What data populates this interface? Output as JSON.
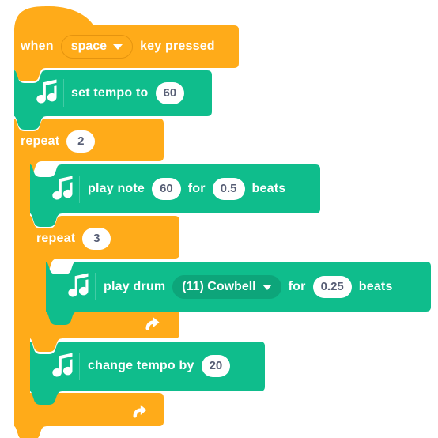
{
  "editor": {
    "name": "scratch-block-script",
    "background_color": "#ffffff"
  },
  "palette": {
    "events_orange": "#ffab19",
    "events_orange_dark": "#e5940f",
    "control_orange": "#ffab19",
    "music_green": "#0fbd8c",
    "music_green_dark": "#0da57a",
    "input_white": "#ffffff",
    "input_text": "#575e75",
    "label_white": "#ffffff"
  },
  "script": {
    "hat": {
      "name": "when-key-pressed",
      "prefix": "when",
      "key_value": "space",
      "suffix": "key pressed",
      "category": "events"
    },
    "set_tempo": {
      "name": "set-tempo-to",
      "label": "set tempo to",
      "value": "60",
      "category": "music",
      "icon": "music-notes-icon"
    },
    "outer_repeat": {
      "name": "repeat-loop-outer",
      "label": "repeat",
      "value": "2",
      "category": "control",
      "loop_icon": "loop-arrow-icon"
    },
    "play_note": {
      "name": "play-note-for-beats",
      "label": "play note",
      "note_value": "60",
      "mid_label": "for",
      "beats_value": "0.5",
      "end_label": "beats",
      "category": "music",
      "icon": "music-notes-icon"
    },
    "inner_repeat": {
      "name": "repeat-loop-inner",
      "label": "repeat",
      "value": "3",
      "category": "control",
      "loop_icon": "loop-arrow-icon"
    },
    "play_drum": {
      "name": "play-drum-for-beats",
      "label": "play drum",
      "drum_value": "(11) Cowbell",
      "mid_label": "for",
      "beats_value": "0.25",
      "end_label": "beats",
      "category": "music",
      "icon": "music-notes-icon"
    },
    "change_tempo": {
      "name": "change-tempo-by",
      "label": "change tempo by",
      "value": "20",
      "category": "music",
      "icon": "music-notes-icon"
    }
  }
}
